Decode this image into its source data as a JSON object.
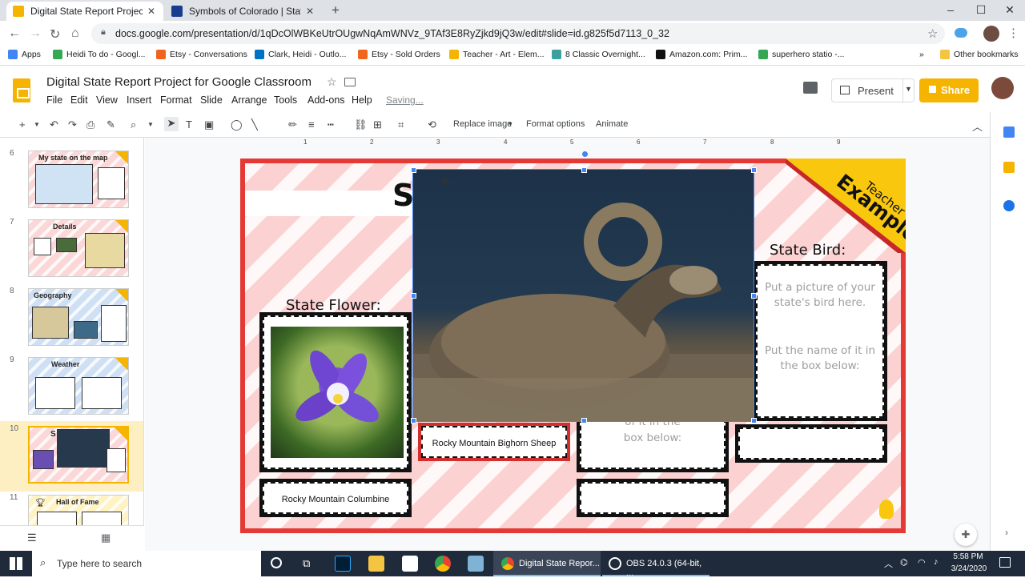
{
  "browser": {
    "tabs": [
      {
        "title": "Digital State Report Project for G",
        "active": true
      },
      {
        "title": "Symbols of Colorado | State Sym",
        "active": false
      }
    ],
    "new_tab": "+",
    "url": "docs.google.com/presentation/d/1qDcOlWBKeUtrOUgwNqAmWNVz_9TAf3E8RyZjkd9jQ3w/edit#slide=id.g825f5d7113_0_32",
    "bookmarks": [
      {
        "label": "Apps",
        "color": "#4285f4"
      },
      {
        "label": "Heidi To do - Googl...",
        "color": "#34a853"
      },
      {
        "label": "Etsy - Conversations",
        "color": "#f1641e"
      },
      {
        "label": "Clark, Heidi - Outlo...",
        "color": "#0072c6"
      },
      {
        "label": "Etsy - Sold Orders",
        "color": "#f1641e"
      },
      {
        "label": "Teacher - Art - Elem...",
        "color": "#f4b400"
      },
      {
        "label": "8 Classic Overnight...",
        "color": "#3aa0a0"
      },
      {
        "label": "Amazon.com: Prim...",
        "color": "#111111"
      },
      {
        "label": "superhero statio -...",
        "color": "#34a853"
      }
    ],
    "bookmarks_more": "»",
    "other_bookmarks": "Other bookmarks"
  },
  "app": {
    "title": "Digital State Report Project for Google Classroom",
    "menu": [
      "File",
      "Edit",
      "View",
      "Insert",
      "Format",
      "Slide",
      "Arrange",
      "Tools",
      "Add-ons",
      "Help"
    ],
    "saving": "Saving...",
    "present_label": "Present",
    "share_label": "Share",
    "accent": "#f4b400"
  },
  "toolbar": {
    "replace_image": "Replace image",
    "format_options": "Format options",
    "animate": "Animate"
  },
  "filmstrip": {
    "slides": [
      {
        "num": "6",
        "title": "My state on the map"
      },
      {
        "num": "7",
        "title": "Details"
      },
      {
        "num": "8",
        "title": "Geography"
      },
      {
        "num": "9",
        "title": "Weather"
      },
      {
        "num": "10",
        "title": "S",
        "selected": true
      },
      {
        "num": "11",
        "title": "Hall of Fame"
      }
    ]
  },
  "ruler": [
    "1",
    "2",
    "3",
    "4",
    "5",
    "6",
    "7",
    "8",
    "9"
  ],
  "slide": {
    "teacher": "Teacher",
    "example": "Example",
    "title_partial": "S",
    "state_flower_label": "State Flower:",
    "state_flower_name": "Rocky Mountain Columbine",
    "state_animal_name": "Rocky Mountain Bighorn Sheep",
    "state_bird_label": "State Bird:",
    "bird_instructions_1": "Put a picture of your state's bird here.",
    "bird_instructions_2": "Put the name of it in the box below:",
    "hidden_partial": "of it in the",
    "hidden_partial_2": "box below:"
  },
  "taskbar": {
    "search_placeholder": "Type here to search",
    "active_app": "Digital State Repor...",
    "obs_app": "OBS 24.0.3 (64-bit, ...",
    "time": "5:58 PM",
    "date": "3/24/2020"
  }
}
